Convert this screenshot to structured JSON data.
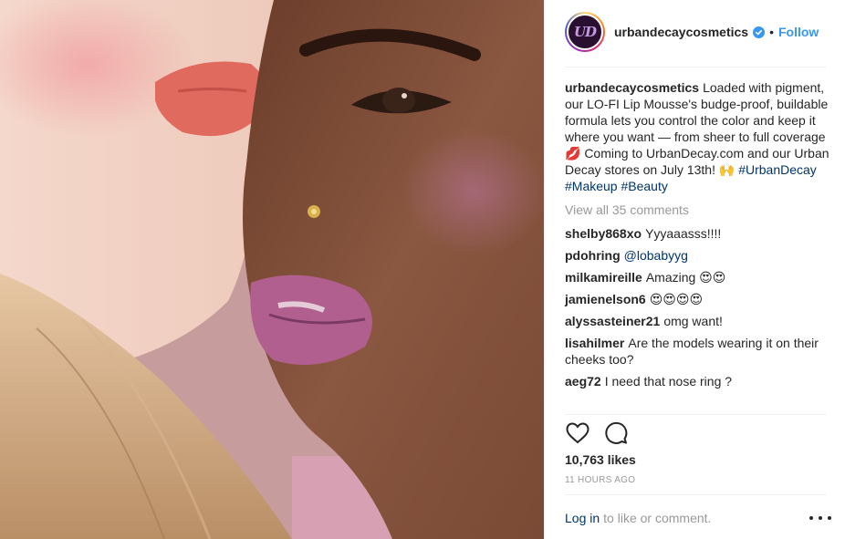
{
  "post": {
    "username": "urbandecaycosmetics",
    "avatar_text": "UD",
    "verified_icon": "verified-badge-icon",
    "separator": "•",
    "follow_label": "Follow",
    "caption": {
      "username": "urbandecaycosmetics",
      "text": "Loaded with pigment, our LO-FI Lip Mousse's budge-proof, buildable formula lets you control the color and keep it where you want — from sheer to full coverage💋 Coming to UrbanDecay.com and our Urban Decay stores on July 13th! 🙌",
      "hashtags": [
        "#UrbanDecay",
        "#Makeup",
        "#Beauty"
      ]
    },
    "view_all_comments": "View all 35 comments",
    "comments": [
      {
        "user": "shelby868xo",
        "text": "Yyyaaasss!!!!",
        "mention": ""
      },
      {
        "user": "pdohring",
        "text": "",
        "mention": "@lobabyyg"
      },
      {
        "user": "milkamireille",
        "text": "Amazing 😍😍",
        "mention": ""
      },
      {
        "user": "jamienelson6",
        "text": "😍😍😍😍",
        "mention": ""
      },
      {
        "user": "alyssasteiner21",
        "text": "omg want!",
        "mention": ""
      },
      {
        "user": "lisahilmer",
        "text": "Are the models wearing it on their cheeks too?",
        "mention": ""
      },
      {
        "user": "aeg72",
        "text": "I need that nose ring ?",
        "mention": ""
      }
    ],
    "actions": {
      "like_icon": "heart-icon",
      "comment_icon": "comment-icon"
    },
    "likes": "10,763 likes",
    "timestamp": "11 HOURS AGO",
    "footer": {
      "login_label": "Log in",
      "rest": "to like or comment.",
      "more_icon": "more-options-icon"
    }
  },
  "colors": {
    "accent": "#3897f0",
    "link": "#003569",
    "muted": "#999999",
    "text": "#262626"
  }
}
